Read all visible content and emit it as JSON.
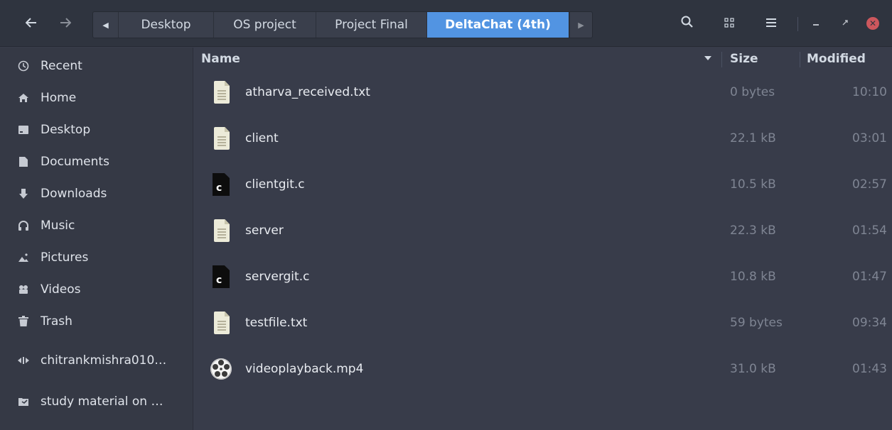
{
  "headerbar": {
    "back_icon": "arrow-left-icon",
    "forward_icon": "arrow-right-icon",
    "path": [
      {
        "label": "Desktop",
        "current": false
      },
      {
        "label": "OS project",
        "current": false
      },
      {
        "label": "Project Final",
        "current": false
      },
      {
        "label": "DeltaChat (4th)",
        "current": true
      }
    ],
    "search_icon": "search-icon",
    "grid_icon": "grid-view-icon",
    "menu_icon": "hamburger-menu-icon",
    "minimize_icon": "minimize-icon",
    "maximize_icon": "maximize-icon",
    "close_icon": "close-icon"
  },
  "sidebar": {
    "items": [
      {
        "label": "Recent",
        "icon": "clock-icon"
      },
      {
        "label": "Home",
        "icon": "home-icon"
      },
      {
        "label": "Desktop",
        "icon": "desktop-icon"
      },
      {
        "label": "Documents",
        "icon": "document-icon"
      },
      {
        "label": "Downloads",
        "icon": "download-icon"
      },
      {
        "label": "Music",
        "icon": "headphones-icon"
      },
      {
        "label": "Pictures",
        "icon": "pictures-icon"
      },
      {
        "label": "Videos",
        "icon": "videos-icon"
      },
      {
        "label": "Trash",
        "icon": "trash-icon"
      },
      {
        "label": "chitrankmishra010…",
        "icon": "network-icon"
      },
      {
        "label": "study material on …",
        "icon": "folder-icon"
      }
    ]
  },
  "columns": {
    "name": "Name",
    "size": "Size",
    "modified": "Modified"
  },
  "files": [
    {
      "name": "atharva_received.txt",
      "size": "0 bytes",
      "modified": "10:10",
      "icon": "text-file-icon"
    },
    {
      "name": "client",
      "size": "22.1 kB",
      "modified": "03:01",
      "icon": "text-file-icon"
    },
    {
      "name": "clientgit.c",
      "size": "10.5 kB",
      "modified": "02:57",
      "icon": "c-source-icon"
    },
    {
      "name": "server",
      "size": "22.3 kB",
      "modified": "01:54",
      "icon": "text-file-icon"
    },
    {
      "name": "servergit.c",
      "size": "10.8 kB",
      "modified": "01:47",
      "icon": "c-source-icon"
    },
    {
      "name": "testfile.txt",
      "size": "59 bytes",
      "modified": "09:34",
      "icon": "text-file-icon"
    },
    {
      "name": "videoplayback.mp4",
      "size": "31.0 kB",
      "modified": "01:43",
      "icon": "video-file-icon"
    }
  ],
  "colors": {
    "accent": "#5294e2",
    "close": "#cc575d",
    "background": "#383c4a",
    "sidebar": "#353945",
    "headerbar": "#2f343f"
  }
}
